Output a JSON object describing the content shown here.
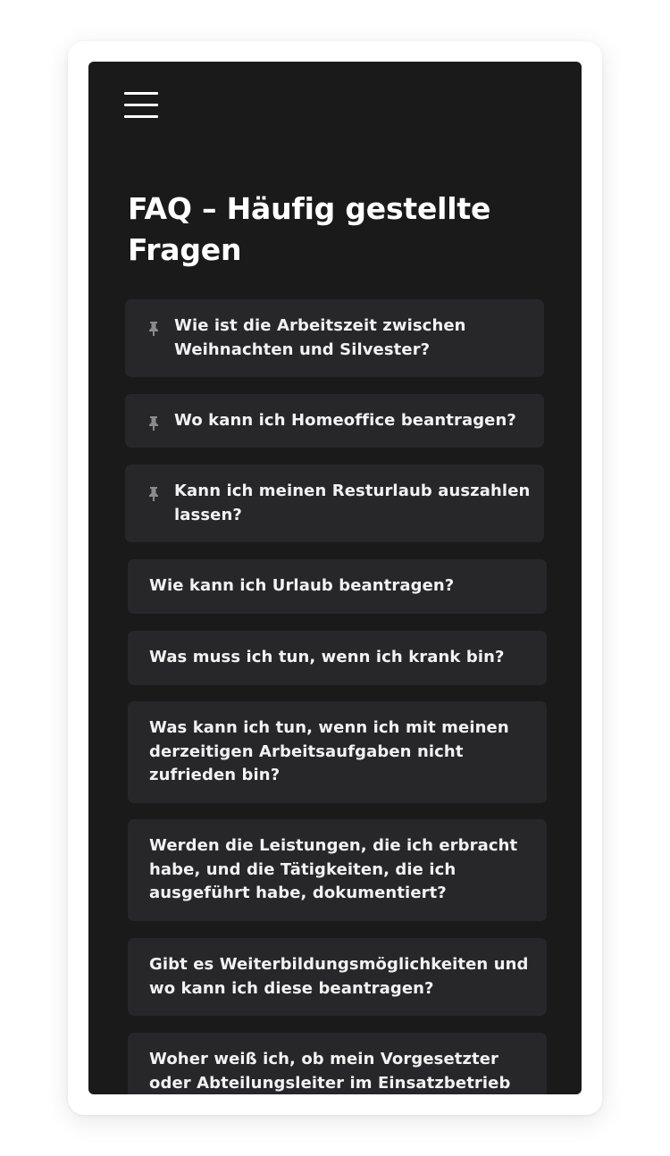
{
  "header": {
    "menu_icon": "hamburger-menu-icon"
  },
  "page": {
    "title_line1": "FAQ – Häufig gestellte",
    "title_line2": "Fragen"
  },
  "faq": {
    "pin_icon": "pin-icon",
    "items": [
      {
        "pinned": true,
        "lines": [
          "Wie ist die Arbeitszeit zwischen",
          "Weihnachten und Silvester?"
        ]
      },
      {
        "pinned": true,
        "lines": [
          "Wo kann ich Homeoffice beantragen?"
        ]
      },
      {
        "pinned": true,
        "lines": [
          "Kann ich meinen Resturlaub auszahlen",
          "lassen?"
        ]
      },
      {
        "pinned": false,
        "lines": [
          "Wie kann ich Urlaub beantragen?"
        ]
      },
      {
        "pinned": false,
        "lines": [
          "Was muss ich tun, wenn ich krank bin?"
        ]
      },
      {
        "pinned": false,
        "lines": [
          "Was kann ich tun, wenn ich mit meinen",
          "derzeitigen Arbeitsaufgaben nicht",
          "zufrieden bin?"
        ]
      },
      {
        "pinned": false,
        "lines": [
          "Werden die Leistungen, die ich erbracht",
          "habe, und die Tätigkeiten, die ich",
          "ausgeführt habe, dokumentiert?"
        ]
      },
      {
        "pinned": false,
        "lines": [
          "Gibt es Weiterbildungsmöglichkeiten und",
          "wo kann ich diese beantragen?"
        ]
      },
      {
        "pinned": false,
        "lines": [
          "Woher weiß ich, ob mein Vorgesetzter",
          "oder Abteilungsleiter im Einsatzbetrieb"
        ]
      }
    ]
  },
  "colors": {
    "screen_background": "#1a1a1b",
    "card_background": "#27272a",
    "text": "#ffffff",
    "pin_icon": "#8a8a8e"
  }
}
